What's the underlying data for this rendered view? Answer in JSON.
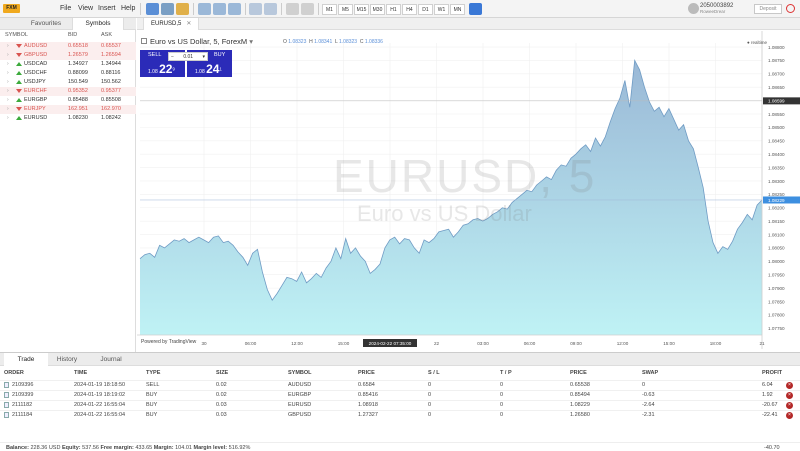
{
  "app": {
    "logo": "FXM",
    "menu": [
      "File",
      "View",
      "Insert",
      "Help"
    ]
  },
  "timeframes": [
    "M1",
    "M5",
    "M15",
    "M30",
    "H1",
    "H4",
    "D1",
    "W1",
    "MN"
  ],
  "account": {
    "number": "2050003892",
    "name": "RoweeDrear",
    "deposit_label": "Deposit"
  },
  "market_watch": {
    "tabs": [
      "Favourites",
      "Symbols"
    ],
    "headers": {
      "symbol": "SYMBOL",
      "bid": "BID",
      "ask": "ASK"
    },
    "rows": [
      {
        "symbol": "AUDUSD",
        "bid": "0.65518",
        "ask": "0.65537",
        "dir": "down"
      },
      {
        "symbol": "GBPUSD",
        "bid": "1.26579",
        "ask": "1.26594",
        "dir": "down"
      },
      {
        "symbol": "USDCAD",
        "bid": "1.34927",
        "ask": "1.34944",
        "dir": "up"
      },
      {
        "symbol": "USDCHF",
        "bid": "0.88099",
        "ask": "0.88116",
        "dir": "up"
      },
      {
        "symbol": "USDJPY",
        "bid": "150.549",
        "ask": "150.562",
        "dir": "up"
      },
      {
        "symbol": "EURCHF",
        "bid": "0.95352",
        "ask": "0.95377",
        "dir": "down"
      },
      {
        "symbol": "EURGBP",
        "bid": "0.85488",
        "ask": "0.85508",
        "dir": "up"
      },
      {
        "symbol": "EURJPY",
        "bid": "162.951",
        "ask": "162.970",
        "dir": "down"
      },
      {
        "symbol": "EURUSD",
        "bid": "1.08230",
        "ask": "1.08242",
        "dir": "up"
      }
    ]
  },
  "chart": {
    "tab_label": "EURUSD,5",
    "title": "Euro vs US Dollar, 5, ForexM",
    "ohlc": {
      "o_label": "O",
      "o": "1.08323",
      "h_label": "H",
      "h": "1.08341",
      "l_label": "L",
      "l": "1.08323",
      "c_label": "C",
      "c": "1.08336"
    },
    "realtime_label": "realtime",
    "watermark_symbol": "EURUSD, 5",
    "watermark_name": "Euro vs US Dollar",
    "powered_by": "Powered by TradingView",
    "trade": {
      "sell_label": "SELL",
      "buy_label": "BUY",
      "lot": "0.01",
      "sell_price_prefix": "1.08",
      "sell_price_big": "22",
      "sell_price_sup": "9",
      "buy_price_prefix": "1.08",
      "buy_price_big": "24",
      "buy_price_sup": "1"
    }
  },
  "chart_data": {
    "type": "area",
    "title": "Euro vs US Dollar, 5, ForexM",
    "xlabel": "",
    "ylabel": "",
    "x_ticks": [
      "30",
      "06:00",
      "12:00",
      "15:00",
      "2024-02-22 07:35:00",
      "22",
      "03:00",
      "06:00",
      "09:00",
      "12:00",
      "15:00",
      "18:00",
      "21"
    ],
    "y_ticks": [
      "1.08800",
      "1.08750",
      "1.08700",
      "1.08650",
      "1.08600",
      "1.08550",
      "1.08500",
      "1.08450",
      "1.08400",
      "1.08350",
      "1.08300",
      "1.08250",
      "1.08200",
      "1.08150",
      "1.08100",
      "1.08050",
      "1.08000",
      "1.07950",
      "1.07900",
      "1.07850",
      "1.07800",
      "1.07750"
    ],
    "ylim": [
      1.07725,
      1.08815
    ],
    "price_marker": "1.08599",
    "current_price": "1.08229",
    "grid": true,
    "series": [
      {
        "values": [
          1.0801,
          1.08025,
          1.0803,
          1.08015,
          1.0806,
          1.0805,
          1.08065,
          1.0808,
          1.08075,
          1.08085,
          1.0807,
          1.0808,
          1.0809,
          1.0808,
          1.0807,
          1.0809,
          1.08095,
          1.0807,
          1.08075,
          1.0806,
          1.08035,
          1.08015,
          1.07985,
          1.0803,
          1.08045,
          1.0796,
          1.07895,
          1.07855,
          1.0788,
          1.0791,
          1.0794,
          1.07935,
          1.07925,
          1.0796,
          1.0792,
          1.07935,
          1.07955,
          1.0794,
          1.07975,
          1.08,
          1.0805,
          1.0801,
          1.08085,
          1.0803,
          1.0805,
          1.0802,
          1.08,
          1.07955,
          1.0797,
          1.0799,
          1.0805,
          1.0808,
          1.0809,
          1.08065,
          1.08085,
          1.0808,
          1.0805,
          1.0803,
          1.0808,
          1.0807,
          1.08085,
          1.0811,
          1.08115,
          1.0812,
          1.0809,
          1.0811,
          1.08135,
          1.0814,
          1.08155,
          1.0816,
          1.0815,
          1.0816,
          1.08175,
          1.08185,
          1.082,
          1.08195,
          1.0822,
          1.08235,
          1.0825,
          1.08265,
          1.0826,
          1.08285,
          1.083,
          1.08315,
          1.08305,
          1.0834,
          1.0836,
          1.08355,
          1.08385,
          1.084,
          1.0842,
          1.08435,
          1.0841,
          1.0846,
          1.0843,
          1.08465,
          1.0852,
          1.0857,
          1.0861,
          1.08675,
          1.08575,
          1.0875,
          1.08715,
          1.0865,
          1.08595,
          1.0856,
          1.08575,
          1.0854,
          1.0857,
          1.0853,
          1.0849,
          1.0851,
          1.0845,
          1.0842,
          1.0835,
          1.08275,
          1.0815,
          1.0807,
          1.0803,
          1.08055,
          1.08045,
          1.08075,
          1.0812,
          1.08145,
          1.08175,
          1.08155,
          1.0821,
          1.08229
        ]
      }
    ]
  },
  "bottom": {
    "tabs": [
      "Trade",
      "History",
      "Journal"
    ],
    "headers": [
      "ORDER",
      "TIME",
      "TYPE",
      "SIZE",
      "SYMBOL",
      "PRICE",
      "S / L",
      "T / P",
      "PRICE",
      "SWAP",
      "PROFIT"
    ],
    "rows": [
      [
        "2109396",
        "2024-01-19 18:18:50",
        "SELL",
        "0.02",
        "AUDUSD",
        "0.6584",
        "0",
        "0",
        "0.65538",
        "0",
        "6.04"
      ],
      [
        "2109399",
        "2024-01-19 18:19:02",
        "BUY",
        "0.02",
        "EURGBP",
        "0.85416",
        "0",
        "0",
        "0.85494",
        "-0.63",
        "1.92"
      ],
      [
        "2111182",
        "2024-01-22 16:55:04",
        "BUY",
        "0.03",
        "EURUSD",
        "1.08918",
        "0",
        "0",
        "1.08229",
        "-2.64",
        "-20.67"
      ],
      [
        "2111184",
        "2024-01-22 16:55:04",
        "BUY",
        "0.03",
        "GBPUSD",
        "1.27327",
        "0",
        "0",
        "1.26580",
        "-2.31",
        "-22.41"
      ]
    ],
    "balance_label": "Balance:",
    "balance": "228.36 USD",
    "equity_label": "Equity:",
    "equity": "537.56",
    "free_margin_label": "Free margin:",
    "free_margin": "433.65",
    "margin_label": "Margin:",
    "margin": "104.01",
    "margin_level_label": "Margin level:",
    "margin_level": "516.92%",
    "total_profit": "-40.70"
  },
  "colors": {
    "area_fill_top": "#9ab8d6",
    "area_fill_bottom": "#bff2f5",
    "line": "#6f9bc4",
    "sell_buy": "#2b2bb8",
    "price_label": "#3d8fe0"
  }
}
